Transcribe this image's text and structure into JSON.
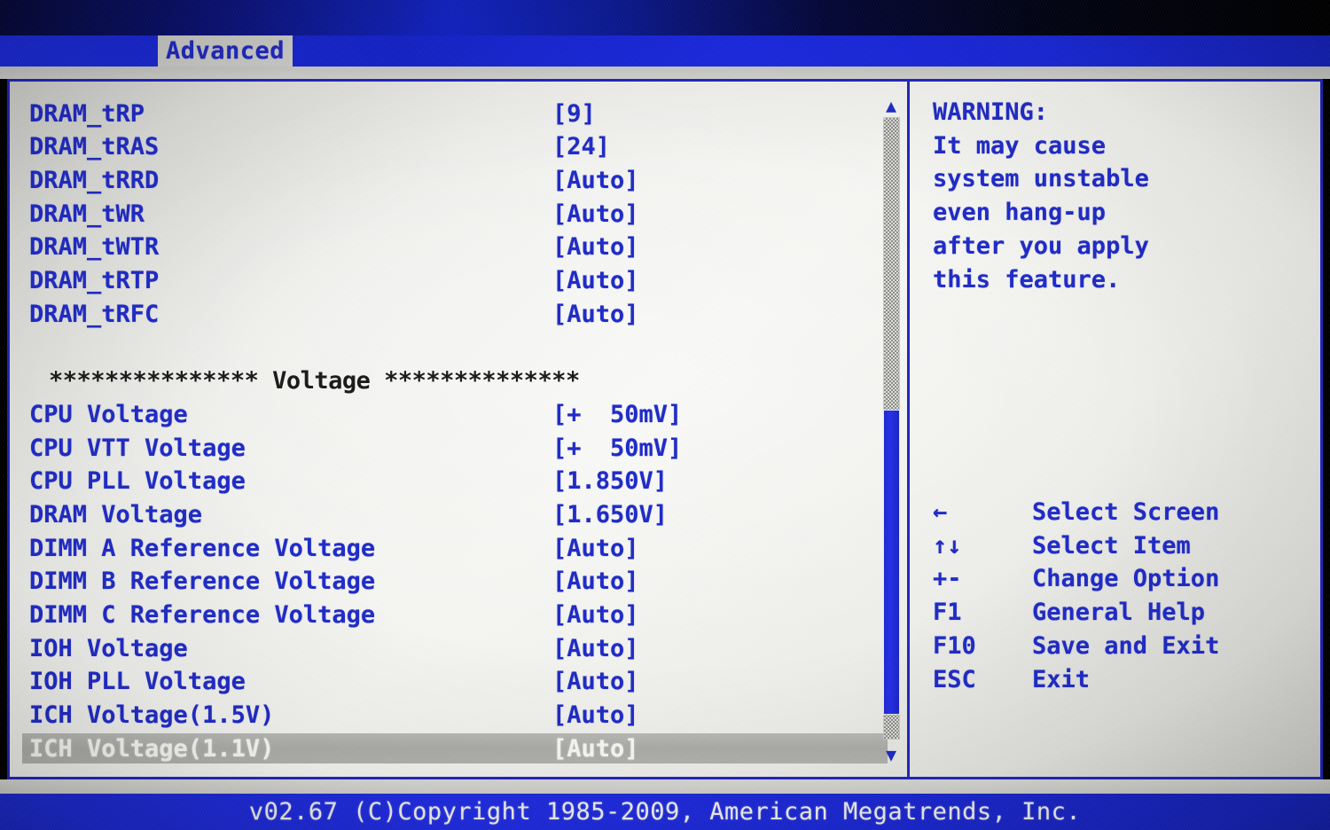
{
  "tab": {
    "label": "Advanced"
  },
  "settings": [
    {
      "label": "DRAM_tRP",
      "value": "[9]",
      "selected": false
    },
    {
      "label": "DRAM_tRAS",
      "value": "[24]",
      "selected": false
    },
    {
      "label": "DRAM_tRRD",
      "value": "[Auto]",
      "selected": false
    },
    {
      "label": "DRAM_tWR",
      "value": "[Auto]",
      "selected": false
    },
    {
      "label": "DRAM_tWTR",
      "value": "[Auto]",
      "selected": false
    },
    {
      "label": "DRAM_tRTP",
      "value": "[Auto]",
      "selected": false
    },
    {
      "label": "DRAM_tRFC",
      "value": "[Auto]",
      "selected": false
    },
    {
      "label": "CPU Voltage",
      "value": "[+  50mV]",
      "selected": false
    },
    {
      "label": "CPU VTT Voltage",
      "value": "[+  50mV]",
      "selected": false
    },
    {
      "label": "CPU PLL Voltage",
      "value": "[1.850V]",
      "selected": false
    },
    {
      "label": "DRAM Voltage",
      "value": "[1.650V]",
      "selected": false
    },
    {
      "label": "DIMM A Reference Voltage",
      "value": "[Auto]",
      "selected": false
    },
    {
      "label": "DIMM B Reference Voltage",
      "value": "[Auto]",
      "selected": false
    },
    {
      "label": "DIMM C Reference Voltage",
      "value": "[Auto]",
      "selected": false
    },
    {
      "label": "IOH Voltage",
      "value": "[Auto]",
      "selected": false
    },
    {
      "label": "IOH PLL Voltage",
      "value": "[Auto]",
      "selected": false
    },
    {
      "label": "ICH Voltage(1.5V)",
      "value": "[Auto]",
      "selected": false
    },
    {
      "label": "ICH Voltage(1.1V)",
      "value": "[Auto]",
      "selected": true
    }
  ],
  "section_header": {
    "text": "*************** Voltage **************",
    "title": "Voltage"
  },
  "help": {
    "warning_lines": [
      "WARNING:",
      "It may cause",
      "system unstable",
      "even hang-up",
      "after you apply",
      "this feature."
    ],
    "keys": [
      {
        "key": "←",
        "desc": "Select Screen"
      },
      {
        "key": "↑↓",
        "desc": "Select Item"
      },
      {
        "key": "+-",
        "desc": "Change Option"
      },
      {
        "key": "F1",
        "desc": "General Help"
      },
      {
        "key": "F10",
        "desc": "Save and Exit"
      },
      {
        "key": "ESC",
        "desc": "Exit"
      }
    ]
  },
  "scrollbar": {
    "up_arrow": "▲",
    "down_arrow": "▼",
    "thumb_top_pct": 47,
    "thumb_height_pct": 49
  },
  "footer": {
    "text": "v02.67 (C)Copyright 1985-2009, American Megatrends, Inc."
  },
  "colors": {
    "text_blue": "#1f2bc8",
    "panel_bg": "#f2f2ef",
    "border_blue": "#2026c0",
    "bar_blue": "#1a28cf",
    "selected_bg": "#b3b3b0",
    "selected_text": "#fbfbf6",
    "header_black": "#1a1a1a"
  }
}
